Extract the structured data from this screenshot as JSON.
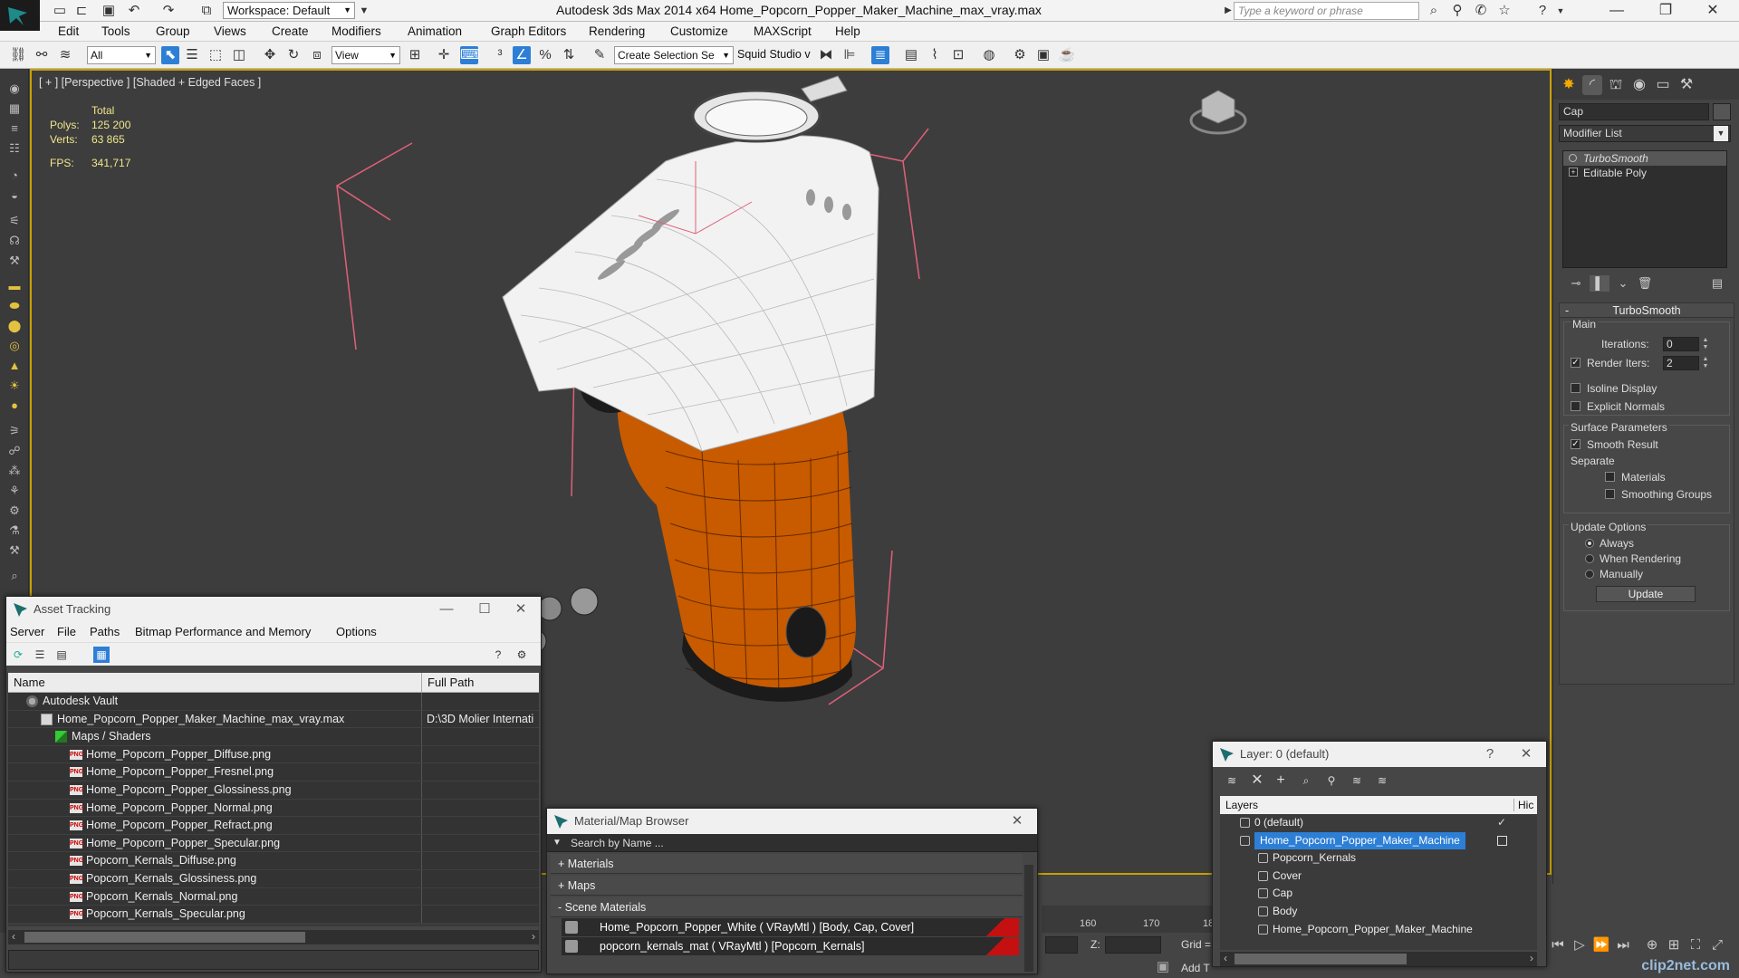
{
  "titlebar": {
    "workspace": "Workspace: Default",
    "app_title": "Autodesk 3ds Max  2014 x64      Home_Popcorn_Popper_Maker_Machine_max_vray.max",
    "search_placeholder": "Type a keyword or phrase"
  },
  "menu": [
    "Edit",
    "Tools",
    "Group",
    "Views",
    "Create",
    "Modifiers",
    "Animation",
    "Graph Editors",
    "Rendering",
    "Customize",
    "MAXScript",
    "Help"
  ],
  "toolbar": {
    "filter": "All",
    "coord": "View",
    "selection_set": "Create Selection Se",
    "squid": "Squid Studio v"
  },
  "viewport": {
    "label": "[ + ] [Perspective ] [Shaded + Edged Faces ]",
    "stats": {
      "total_label": "Total",
      "polys_label": "Polys:",
      "polys": "125 200",
      "verts_label": "Verts:",
      "verts": "63 865",
      "fps_label": "FPS:",
      "fps": "341,717"
    }
  },
  "command_panel": {
    "object_name": "Cap",
    "modifier_list": "Modifier List",
    "stack": [
      {
        "name": "TurboSmooth",
        "selected": true
      },
      {
        "name": "Editable Poly",
        "selected": false
      }
    ],
    "turbosmooth": {
      "title": "TurboSmooth",
      "main": "Main",
      "iterations_label": "Iterations:",
      "iterations": "0",
      "render_iters_label": "Render Iters:",
      "render_iters": "2",
      "isoline": "Isoline Display",
      "explicit_normals": "Explicit Normals",
      "surface_params": "Surface Parameters",
      "smooth_result": "Smooth Result",
      "separate": "Separate",
      "materials": "Materials",
      "smoothing_groups": "Smoothing Groups",
      "update_options": "Update Options",
      "always": "Always",
      "when_rendering": "When Rendering",
      "manually": "Manually",
      "update_btn": "Update"
    }
  },
  "asset_tracking": {
    "title": "Asset Tracking",
    "menu": [
      "Server",
      "File",
      "Paths",
      "Bitmap Performance and Memory",
      "Options"
    ],
    "col_name": "Name",
    "col_path": "Full Path",
    "rows": [
      {
        "name": "Autodesk Vault",
        "path": "",
        "indent": 1,
        "icon": "vault"
      },
      {
        "name": "Home_Popcorn_Popper_Maker_Machine_max_vray.max",
        "path": "D:\\3D Molier Internati",
        "indent": 2,
        "icon": "max"
      },
      {
        "name": "Maps / Shaders",
        "path": "",
        "indent": 3,
        "icon": "maps"
      },
      {
        "name": "Home_Popcorn_Popper_Diffuse.png",
        "path": "",
        "indent": 4,
        "icon": "png"
      },
      {
        "name": "Home_Popcorn_Popper_Fresnel.png",
        "path": "",
        "indent": 4,
        "icon": "png"
      },
      {
        "name": "Home_Popcorn_Popper_Glossiness.png",
        "path": "",
        "indent": 4,
        "icon": "png"
      },
      {
        "name": "Home_Popcorn_Popper_Normal.png",
        "path": "",
        "indent": 4,
        "icon": "png"
      },
      {
        "name": "Home_Popcorn_Popper_Refract.png",
        "path": "",
        "indent": 4,
        "icon": "png"
      },
      {
        "name": "Home_Popcorn_Popper_Specular.png",
        "path": "",
        "indent": 4,
        "icon": "png"
      },
      {
        "name": "Popcorn_Kernals_Diffuse.png",
        "path": "",
        "indent": 4,
        "icon": "png"
      },
      {
        "name": "Popcorn_Kernals_Glossiness.png",
        "path": "",
        "indent": 4,
        "icon": "png"
      },
      {
        "name": "Popcorn_Kernals_Normal.png",
        "path": "",
        "indent": 4,
        "icon": "png"
      },
      {
        "name": "Popcorn_Kernals_Specular.png",
        "path": "",
        "indent": 4,
        "icon": "png"
      }
    ]
  },
  "material_browser": {
    "title": "Material/Map Browser",
    "search_placeholder": "Search by Name ...",
    "groups": [
      "+ Materials",
      "+ Maps",
      "- Scene Materials"
    ],
    "items": [
      "Home_Popcorn_Popper_White  ( VRayMtl )  [Body, Cap, Cover]",
      "popcorn_kernals_mat  ( VRayMtl )  [Popcorn_Kernals]"
    ]
  },
  "layer_window": {
    "title": "Layer: 0 (default)",
    "col_layers": "Layers",
    "col_hide": "Hic",
    "rows": [
      {
        "name": "0 (default)",
        "indent": 0,
        "selected": false,
        "check": true
      },
      {
        "name": "Home_Popcorn_Popper_Maker_Machine",
        "indent": 0,
        "selected": true,
        "check": false
      },
      {
        "name": "Popcorn_Kernals",
        "indent": 1,
        "selected": false,
        "check": false
      },
      {
        "name": "Cover",
        "indent": 1,
        "selected": false,
        "check": false
      },
      {
        "name": "Cap",
        "indent": 1,
        "selected": false,
        "check": false
      },
      {
        "name": "Body",
        "indent": 1,
        "selected": false,
        "check": false
      },
      {
        "name": "Home_Popcorn_Popper_Maker_Machine",
        "indent": 1,
        "selected": false,
        "check": false
      }
    ]
  },
  "timeline": {
    "ticks": [
      "160",
      "170",
      "18"
    ]
  },
  "status": {
    "z_label": "Z:",
    "grid_label": "Grid =",
    "add_label": "Add T"
  },
  "watermark": "clip2net.com",
  "colors": {
    "accent": "#2d7fd6",
    "viewport_border": "#c8a000",
    "body_orange": "#c85a00",
    "bbox_pink": "#e0607a"
  }
}
